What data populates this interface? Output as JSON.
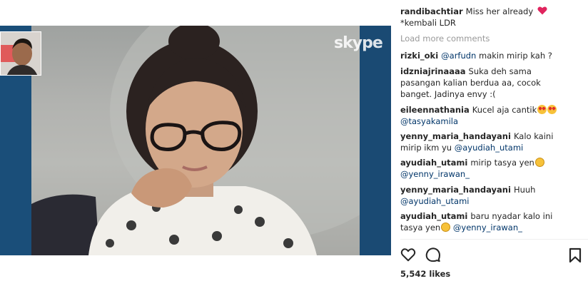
{
  "post": {
    "author": "randibachtiar",
    "caption_line1": "Miss her already",
    "caption_line2": "*kembali LDR",
    "load_more": "Load more comments",
    "likes": "5,542 likes"
  },
  "media": {
    "watermark": "skype"
  },
  "comments": [
    {
      "user": "rizki_oki",
      "mention": "@arfudn",
      "text": "makin mirip kah ?"
    },
    {
      "user": "idzniajrinaaaa",
      "text": "Suka deh sama pasangan kalian berdua aa, cocok banget. Jadinya envy :("
    },
    {
      "user": "eileennathania",
      "text": "Kucel aja cantik",
      "mention": "@tasyakamila"
    },
    {
      "user": "yenny_maria_handayani",
      "text": "Kalo kaini mirip ikm yu",
      "mention": "@ayudiah_utami"
    },
    {
      "user": "ayudiah_utami",
      "text": "mirip tasya yen",
      "mention": "@yenny_irawan_"
    },
    {
      "user": "yenny_maria_handayani",
      "text": "Huuh",
      "mention": "@ayudiah_utami"
    },
    {
      "user": "ayudiah_utami",
      "text": "baru nyadar kalo ini tasya yen",
      "mention": "@yenny_irawan_"
    }
  ],
  "icons": {
    "heart_caption": "heart-icon",
    "like": "heart-outline-icon",
    "comment": "speech-bubble-icon",
    "save": "bookmark-icon"
  },
  "colors": {
    "mention": "#003569",
    "muted": "#999999",
    "text": "#262626",
    "media_bg": "#17456d"
  }
}
